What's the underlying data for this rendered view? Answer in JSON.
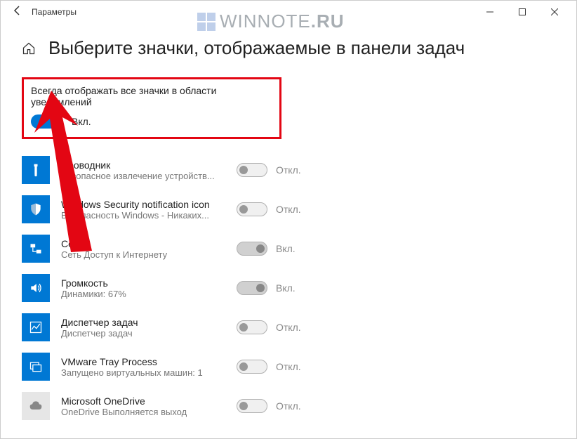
{
  "titlebar": {
    "title": "Параметры"
  },
  "watermark": {
    "text1": "WINNOTE",
    "text2": ".RU"
  },
  "page": {
    "title": "Выберите значки, отображаемые в панели задач"
  },
  "master": {
    "label": "Всегда отображать все значки в области уведомлений",
    "state_label": "Вкл.",
    "on": true
  },
  "items": [
    {
      "title": "Проводник",
      "sub": "Безопасное извлечение устройств...",
      "state_label": "Откл.",
      "icon": "usb",
      "tile": "blue",
      "toggle": "disabled-off"
    },
    {
      "title": "Windows Security notification icon",
      "sub": "Безопасность Windows - Никаких...",
      "state_label": "Откл.",
      "icon": "shield",
      "tile": "blue",
      "toggle": "disabled-off"
    },
    {
      "title": "Сеть",
      "sub": "Сеть Доступ к Интернету",
      "state_label": "Вкл.",
      "icon": "network",
      "tile": "blue",
      "toggle": "disabled-on"
    },
    {
      "title": "Громкость",
      "sub": "Динамики: 67%",
      "state_label": "Вкл.",
      "icon": "volume",
      "tile": "blue",
      "toggle": "disabled-on"
    },
    {
      "title": "Диспетчер задач",
      "sub": "Диспетчер задач",
      "state_label": "Откл.",
      "icon": "taskmgr",
      "tile": "blue",
      "toggle": "disabled-off"
    },
    {
      "title": "VMware Tray Process",
      "sub": "Запущено виртуальных машин: 1",
      "state_label": "Откл.",
      "icon": "vmware",
      "tile": "blue",
      "toggle": "disabled-off"
    },
    {
      "title": "Microsoft OneDrive",
      "sub": "OneDrive Выполняется выход",
      "state_label": "Откл.",
      "icon": "cloud",
      "tile": "grey",
      "toggle": "disabled-off"
    }
  ]
}
